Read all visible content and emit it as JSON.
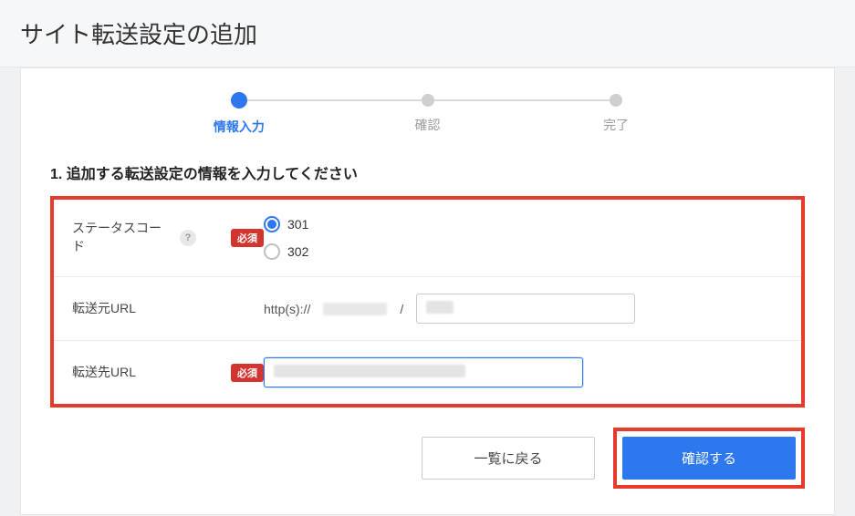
{
  "header": {
    "title": "サイト転送設定の追加"
  },
  "stepper": {
    "steps": [
      {
        "label": "情報入力",
        "active": true
      },
      {
        "label": "確認",
        "active": false
      },
      {
        "label": "完了",
        "active": false
      }
    ]
  },
  "section": {
    "title": "1. 追加する転送設定の情報を入力してください"
  },
  "form": {
    "status_code": {
      "label": "ステータスコード",
      "required_badge": "必須",
      "help": "?",
      "options": [
        {
          "value": "301",
          "selected": true
        },
        {
          "value": "302",
          "selected": false
        }
      ]
    },
    "source_url": {
      "label": "転送元URL",
      "prefix": "http(s)://",
      "slash": "/",
      "path_value": ""
    },
    "dest_url": {
      "label": "転送先URL",
      "required_badge": "必須",
      "value": ""
    }
  },
  "actions": {
    "back": "一覧に戻る",
    "confirm": "確認する"
  }
}
